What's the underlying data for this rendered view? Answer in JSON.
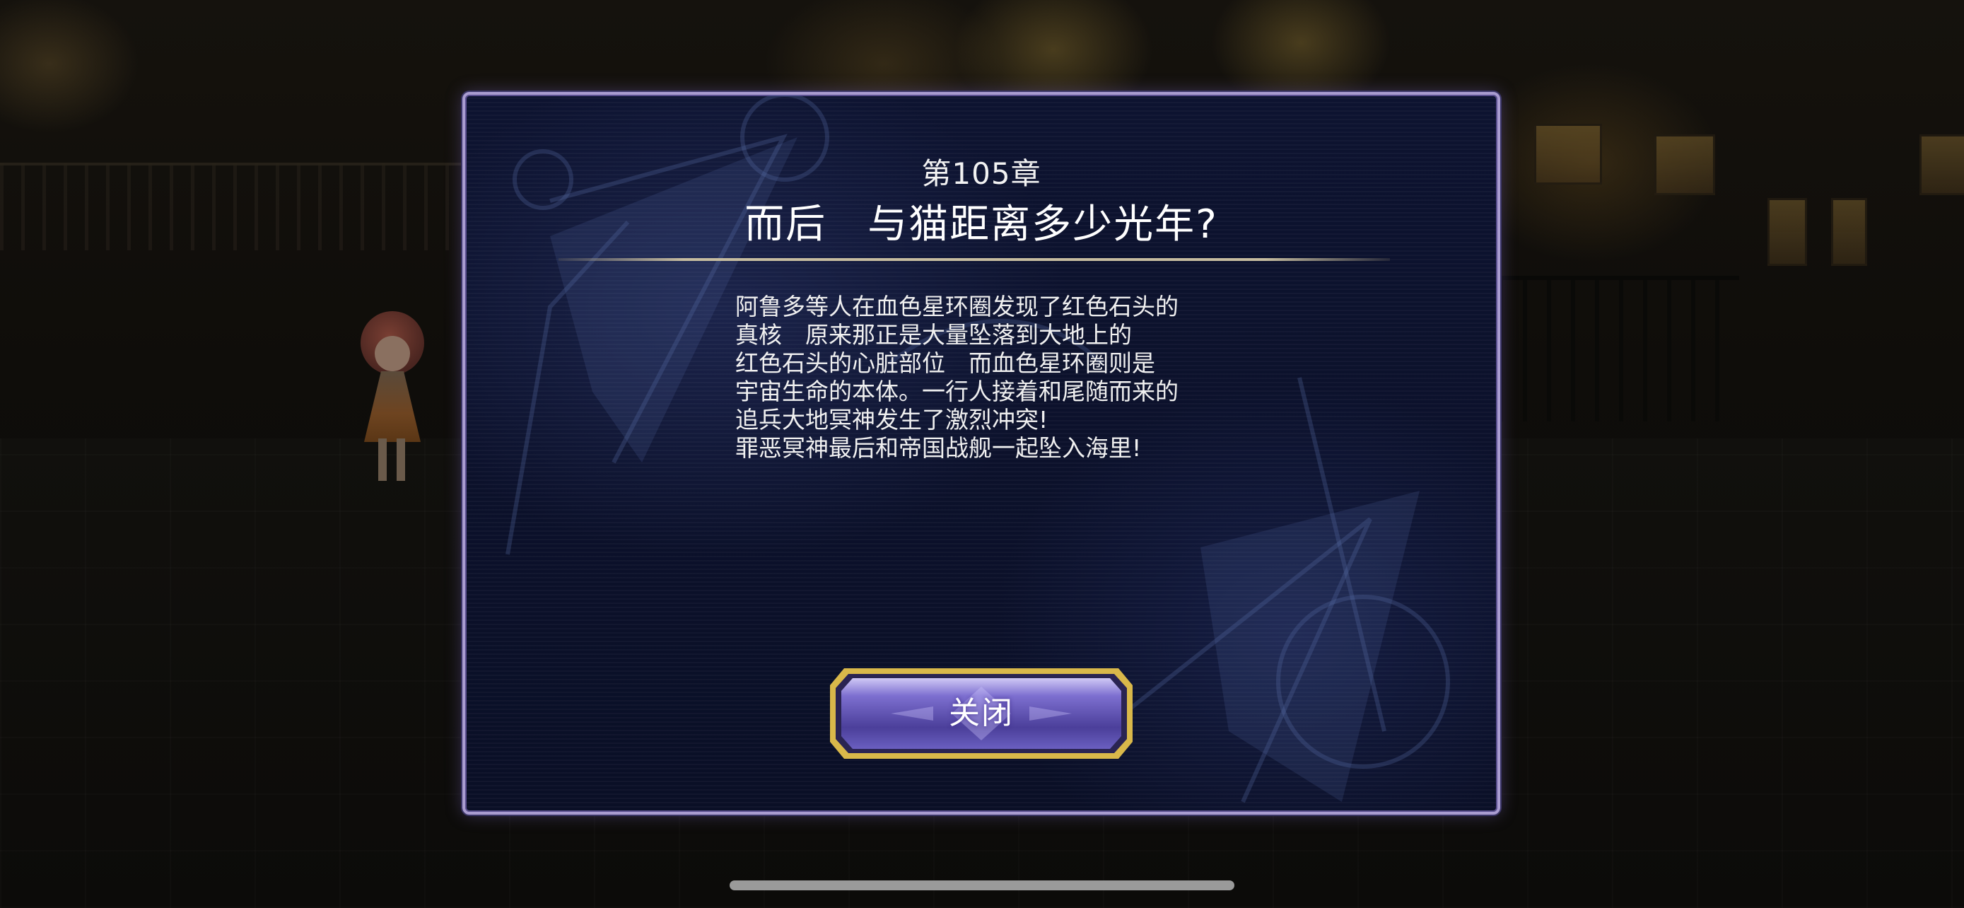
{
  "dialog": {
    "chapter": "第105章",
    "title": "而后　与猫距离多少光年?",
    "body_lines": [
      "阿鲁多等人在血色星环圈发现了红色石头的",
      "真核　原来那正是大量坠落到大地上的",
      "红色石头的心脏部位　而血色星环圈则是",
      "宇宙生命的本体。一行人接着和尾随而来的",
      "追兵大地冥神发生了激烈冲突!",
      "罪恶冥神最后和帝国战舰一起坠入海里!"
    ],
    "close_label": "关闭"
  },
  "colors": {
    "dialog_border": "#a99cd0",
    "button_border": "#d9b84a",
    "button_fill": "#5a4fae",
    "dialog_bg": "#0d1330"
  }
}
